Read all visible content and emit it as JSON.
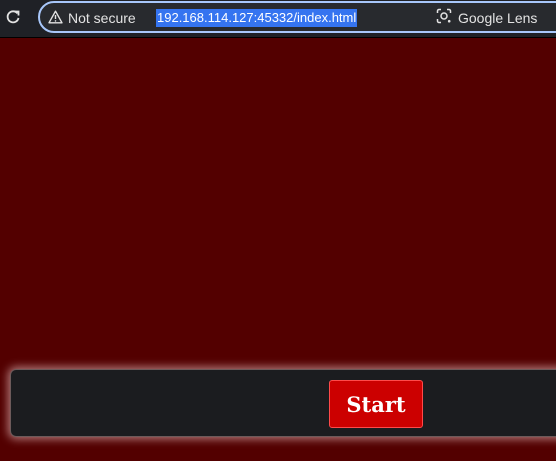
{
  "browser": {
    "reload_icon": "reload-icon",
    "security": {
      "icon": "warning-triangle-icon",
      "label": "Not secure"
    },
    "url": "192.168.114.127:45332/index.html",
    "lens": {
      "icon": "google-lens-icon",
      "label": "Google Lens"
    }
  },
  "game": {
    "start_label": "Start"
  },
  "colors": {
    "page_background": "#530000",
    "toolbar_background": "#1f2126",
    "omnibox_border": "#a8c7fa",
    "url_selection": "#3574f0",
    "control_bar_background": "#1b1c1f",
    "start_button": "#cc0000"
  }
}
